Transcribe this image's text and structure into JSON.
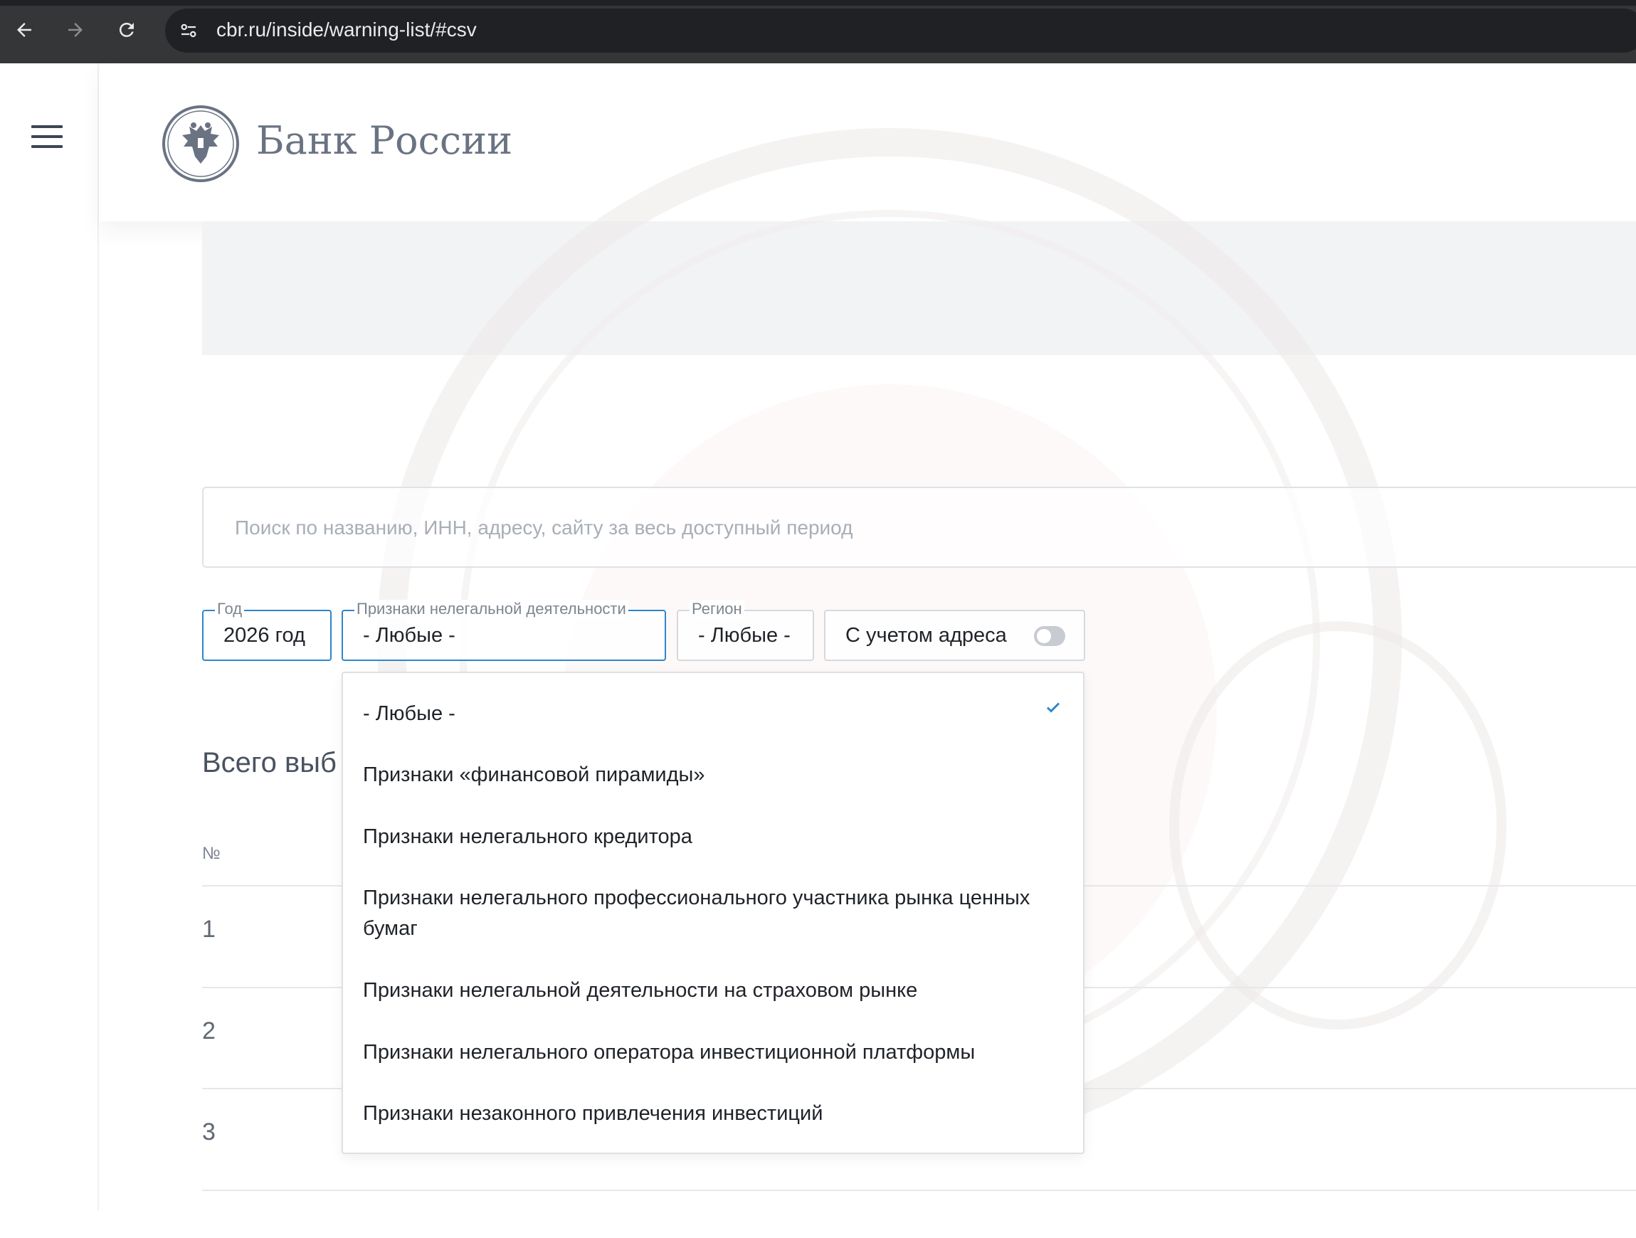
{
  "browser": {
    "url": "cbr.ru/inside/warning-list/#csv"
  },
  "header": {
    "logo_text": "Банк России",
    "logo_emblem": "double-headed-eagle"
  },
  "search": {
    "placeholder": "Поиск по названию, ИНН, адресу, сайту за весь доступный период"
  },
  "filters": {
    "year": {
      "legend": "Год",
      "value": "2026 год"
    },
    "activity": {
      "legend": "Признаки нелегальной деятельности",
      "value": "- Любые -"
    },
    "region": {
      "legend": "Регион",
      "value": "- Любые -"
    },
    "address": {
      "label": "С учетом адреса",
      "toggle_on": false
    }
  },
  "results": {
    "total_label": "Всего выб",
    "col_number": "№",
    "rows": [
      "1",
      "2",
      "3"
    ]
  },
  "dropdown": {
    "selected_index": 0,
    "options": [
      "- Любые -",
      "Признаки «финансовой пирамиды»",
      "Признаки нелегального кредитора",
      "Признаки нелегального профессионального участника рынка ценных бумаг",
      "Признаки нелегальной деятельности на страховом рынке",
      "Признаки нелегального оператора инвестиционной платформы",
      "Признаки незаконного привлечения инвестиций"
    ]
  },
  "colors": {
    "accent": "#2f86c9",
    "chrome": "#353637"
  }
}
